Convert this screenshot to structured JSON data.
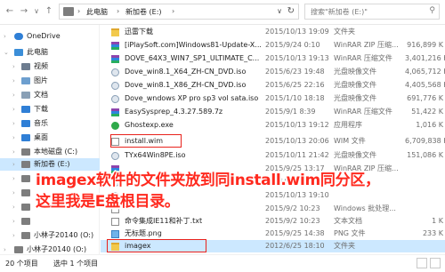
{
  "address": {
    "crumbs": [
      "此电脑",
      "新加卷 (E:)"
    ],
    "search_placeholder": "搜索\"新加卷 (E:)\""
  },
  "sidebar": {
    "items": [
      {
        "label": "OneDrive",
        "icon": "cloud-icon",
        "color": "#2f7fd6"
      },
      {
        "label": "此电脑",
        "icon": "computer-icon",
        "color": "#3b8ed8"
      },
      {
        "label": "视频",
        "icon": "video-folder-icon",
        "color": "#6d7c8f"
      },
      {
        "label": "图片",
        "icon": "pictures-folder-icon",
        "color": "#6d9fcf"
      },
      {
        "label": "文档",
        "icon": "documents-folder-icon",
        "color": "#8aa0b6"
      },
      {
        "label": "下载",
        "icon": "downloads-icon",
        "color": "#2f7fd6"
      },
      {
        "label": "音乐",
        "icon": "music-icon",
        "color": "#2f7fd6"
      },
      {
        "label": "桌面",
        "icon": "desktop-icon",
        "color": "#2f7fd6"
      },
      {
        "label": "本地磁盘 (C:)",
        "icon": "drive-icon",
        "color": "#7d7d7d"
      },
      {
        "label": "新加卷 (E:)",
        "icon": "drive-icon",
        "color": "#7d7d7d"
      },
      {
        "label": "",
        "icon": "drive-icon",
        "color": "#7d7d7d"
      },
      {
        "label": "",
        "icon": "drive-icon",
        "color": "#7d7d7d"
      },
      {
        "label": "",
        "icon": "drive-icon",
        "color": "#7d7d7d"
      },
      {
        "label": "",
        "icon": "drive-icon",
        "color": "#7d7d7d"
      },
      {
        "label": "小林子20140 (O:)",
        "icon": "drive-icon",
        "color": "#7d7d7d"
      },
      {
        "label": "小林子20140 (O:)",
        "icon": "drive-icon",
        "color": "#7d7d7d"
      }
    ]
  },
  "files": [
    {
      "name": "迅雷下载",
      "date": "2015/10/13 19:09",
      "type": "文件夹",
      "size": "",
      "icon": "folder-icon"
    },
    {
      "name": "[iPlaySoft.com]Windows81-Update-X...",
      "date": "2015/9/24 0:10",
      "type": "WinRAR ZIP 压缩...",
      "size": "916,899 K",
      "icon": "rar-icon"
    },
    {
      "name": "DOVE_64X3_WIN7_SP1_ULTIMATE_C...",
      "date": "2015/10/13 19:13",
      "type": "WinRAR 压缩文件",
      "size": "3,401,216 K",
      "icon": "rar-icon"
    },
    {
      "name": "Dove_win8.1_X64_ZH-CN_DVD.iso",
      "date": "2015/6/23 19:48",
      "type": "光盘映像文件",
      "size": "4,065,712 K",
      "icon": "disc-icon"
    },
    {
      "name": "Dove_win8.1_X86_ZH-CN_DVD.iso",
      "date": "2015/6/25 22:16",
      "type": "光盘映像文件",
      "size": "4,405,568 K",
      "icon": "disc-icon"
    },
    {
      "name": "Dove_wndows XP pro sp3 vol sata.iso",
      "date": "2015/1/10 18:18",
      "type": "光盘映像文件",
      "size": "691,776 K",
      "icon": "disc-icon"
    },
    {
      "name": "EasySysprep_4.3.27.589.7z",
      "date": "2015/9/1 8:39",
      "type": "WinRAR 压缩文件",
      "size": "51,422 K",
      "icon": "rar-icon"
    },
    {
      "name": "Ghostexp.exe",
      "date": "2015/10/13 19:12",
      "type": "应用程序",
      "size": "1,016 K",
      "icon": "ghost-icon"
    },
    {
      "name": "install.wim",
      "date": "2015/10/13 20:06",
      "type": "WIM 文件",
      "size": "6,709,838 K",
      "icon": "wim-icon"
    },
    {
      "name": "TYx64Win8PE.iso",
      "date": "2015/10/11 21:42",
      "type": "光盘映像文件",
      "size": "151,086 K",
      "icon": "disc-icon"
    },
    {
      "name": "",
      "date": "2015/9/25 13:17",
      "type": "WinRAR ZIP 压缩...",
      "size": "",
      "icon": "rar-icon"
    },
    {
      "name": "",
      "date": "2015/10/13 19:10",
      "type": "",
      "size": "",
      "icon": "disc-icon"
    },
    {
      "name": "",
      "date": "2015/10/13 19:10",
      "type": "",
      "size": "",
      "icon": "disc-icon"
    },
    {
      "name": "",
      "date": "2015/10/13 19:10",
      "type": "",
      "size": "",
      "icon": "disc-icon"
    },
    {
      "name": "",
      "date": "2015/9/2 10:23",
      "type": "Windows 批处理...",
      "size": "",
      "icon": "txt-icon"
    },
    {
      "name": "命令集成IE11和补丁.txt",
      "date": "2015/9/2 10:23",
      "type": "文本文档",
      "size": "1 K",
      "icon": "txt-icon"
    },
    {
      "name": "无标题.png",
      "date": "2015/9/25 14:38",
      "type": "PNG 文件",
      "size": "233 K",
      "icon": "png-icon"
    },
    {
      "name": "imagex",
      "date": "2012/6/25 18:10",
      "type": "文件夹",
      "size": "",
      "icon": "folder-icon"
    }
  ],
  "overlay": {
    "line1": "imagex软件的文件夹放到同install.wim同分区，",
    "line2": "这里我是E盘根目录。"
  },
  "status": {
    "count": "20 个项目",
    "selected": "选中 1 个项目"
  },
  "colors": {
    "selection": "#cce8ff",
    "annotation": "#e8221c",
    "overlay_text": "#ff2a1f"
  }
}
